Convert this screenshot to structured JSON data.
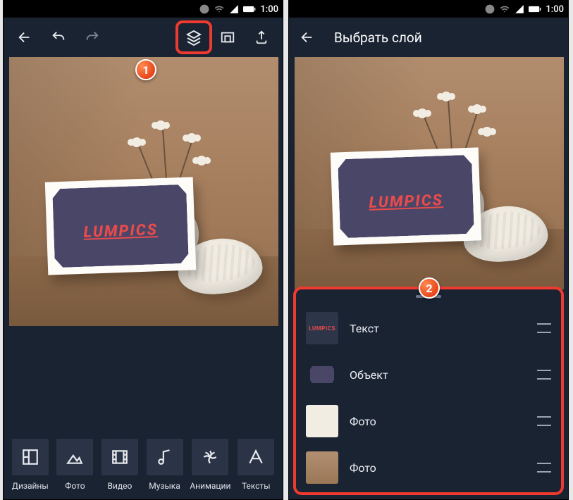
{
  "status": {
    "time": "1:00"
  },
  "callouts": {
    "one": "1",
    "two": "2"
  },
  "canvas": {
    "card_text": "LUMPICS"
  },
  "right_header": {
    "title": "Выбрать слой"
  },
  "tools": [
    {
      "name": "designs",
      "label": "Дизайны"
    },
    {
      "name": "photo",
      "label": "Фото"
    },
    {
      "name": "video",
      "label": "Видео"
    },
    {
      "name": "music",
      "label": "Музыка"
    },
    {
      "name": "anim",
      "label": "Анимации"
    },
    {
      "name": "texts",
      "label": "Тексты"
    }
  ],
  "layers": [
    {
      "kind": "text",
      "label": "Текст",
      "thumb_text": "LUMPICS"
    },
    {
      "kind": "object",
      "label": "Объект"
    },
    {
      "kind": "photo1",
      "label": "Фото"
    },
    {
      "kind": "photo2",
      "label": "Фото"
    }
  ]
}
